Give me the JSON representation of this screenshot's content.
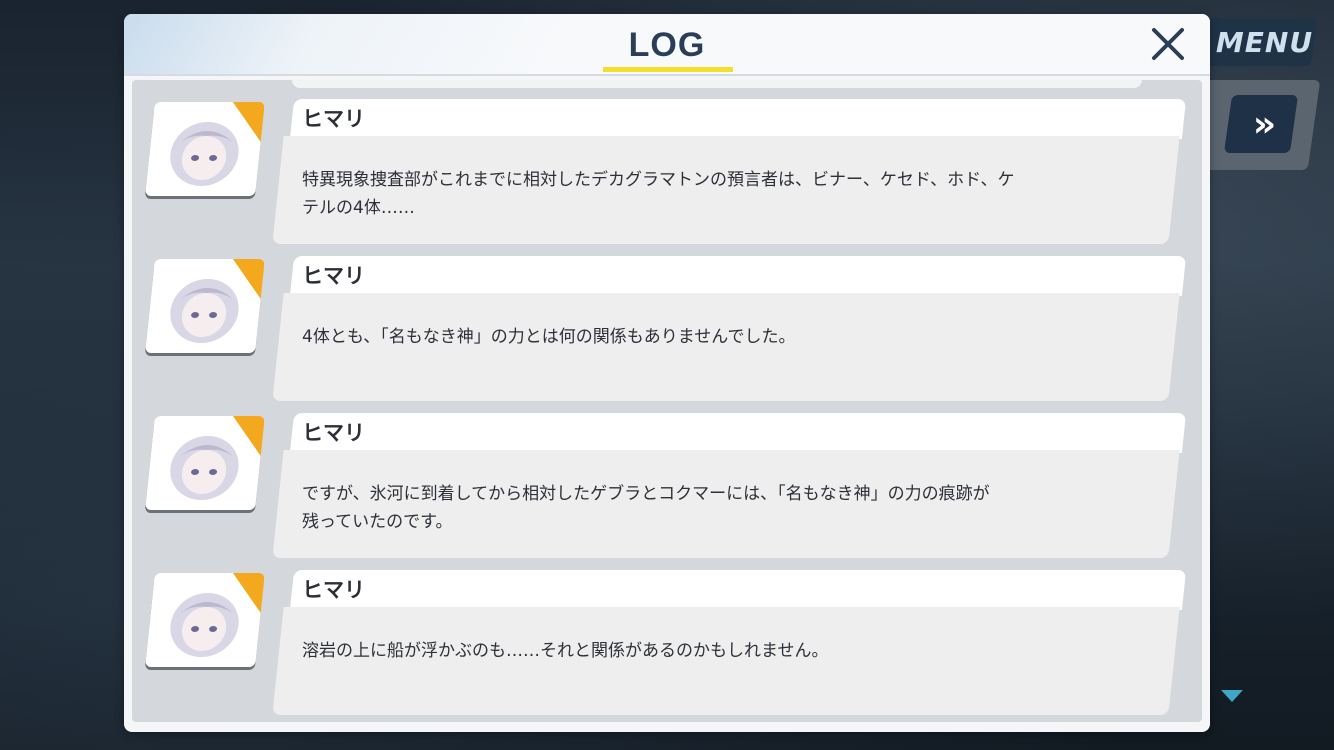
{
  "hud": {
    "menu_label": "MENU",
    "fast_forward_label": "»"
  },
  "log": {
    "title": "LOG",
    "entries": [
      {
        "speaker": "ヒマリ",
        "lines": [
          "特異現象捜査部がこれまでに相対したデカグラマトンの預言者は、ビナー、ケセド、ホド、ケ",
          "テルの4体……"
        ]
      },
      {
        "speaker": "ヒマリ",
        "lines": [
          "4体とも、「名もなき神」の力とは何の関係もありませんでした。"
        ]
      },
      {
        "speaker": "ヒマリ",
        "lines": [
          "ですが、氷河に到着してから相対したゲブラとコクマーには、「名もなき神」の力の痕跡が",
          "残っていたのです。"
        ]
      },
      {
        "speaker": "ヒマリ",
        "lines": [
          "溶岩の上に船が浮かぶのも……それと関係があるのかもしれません。"
        ]
      }
    ]
  },
  "colors": {
    "title": "#2a3e58",
    "underline": "#f6df2a",
    "avatar_accent": "#f4a81e"
  }
}
